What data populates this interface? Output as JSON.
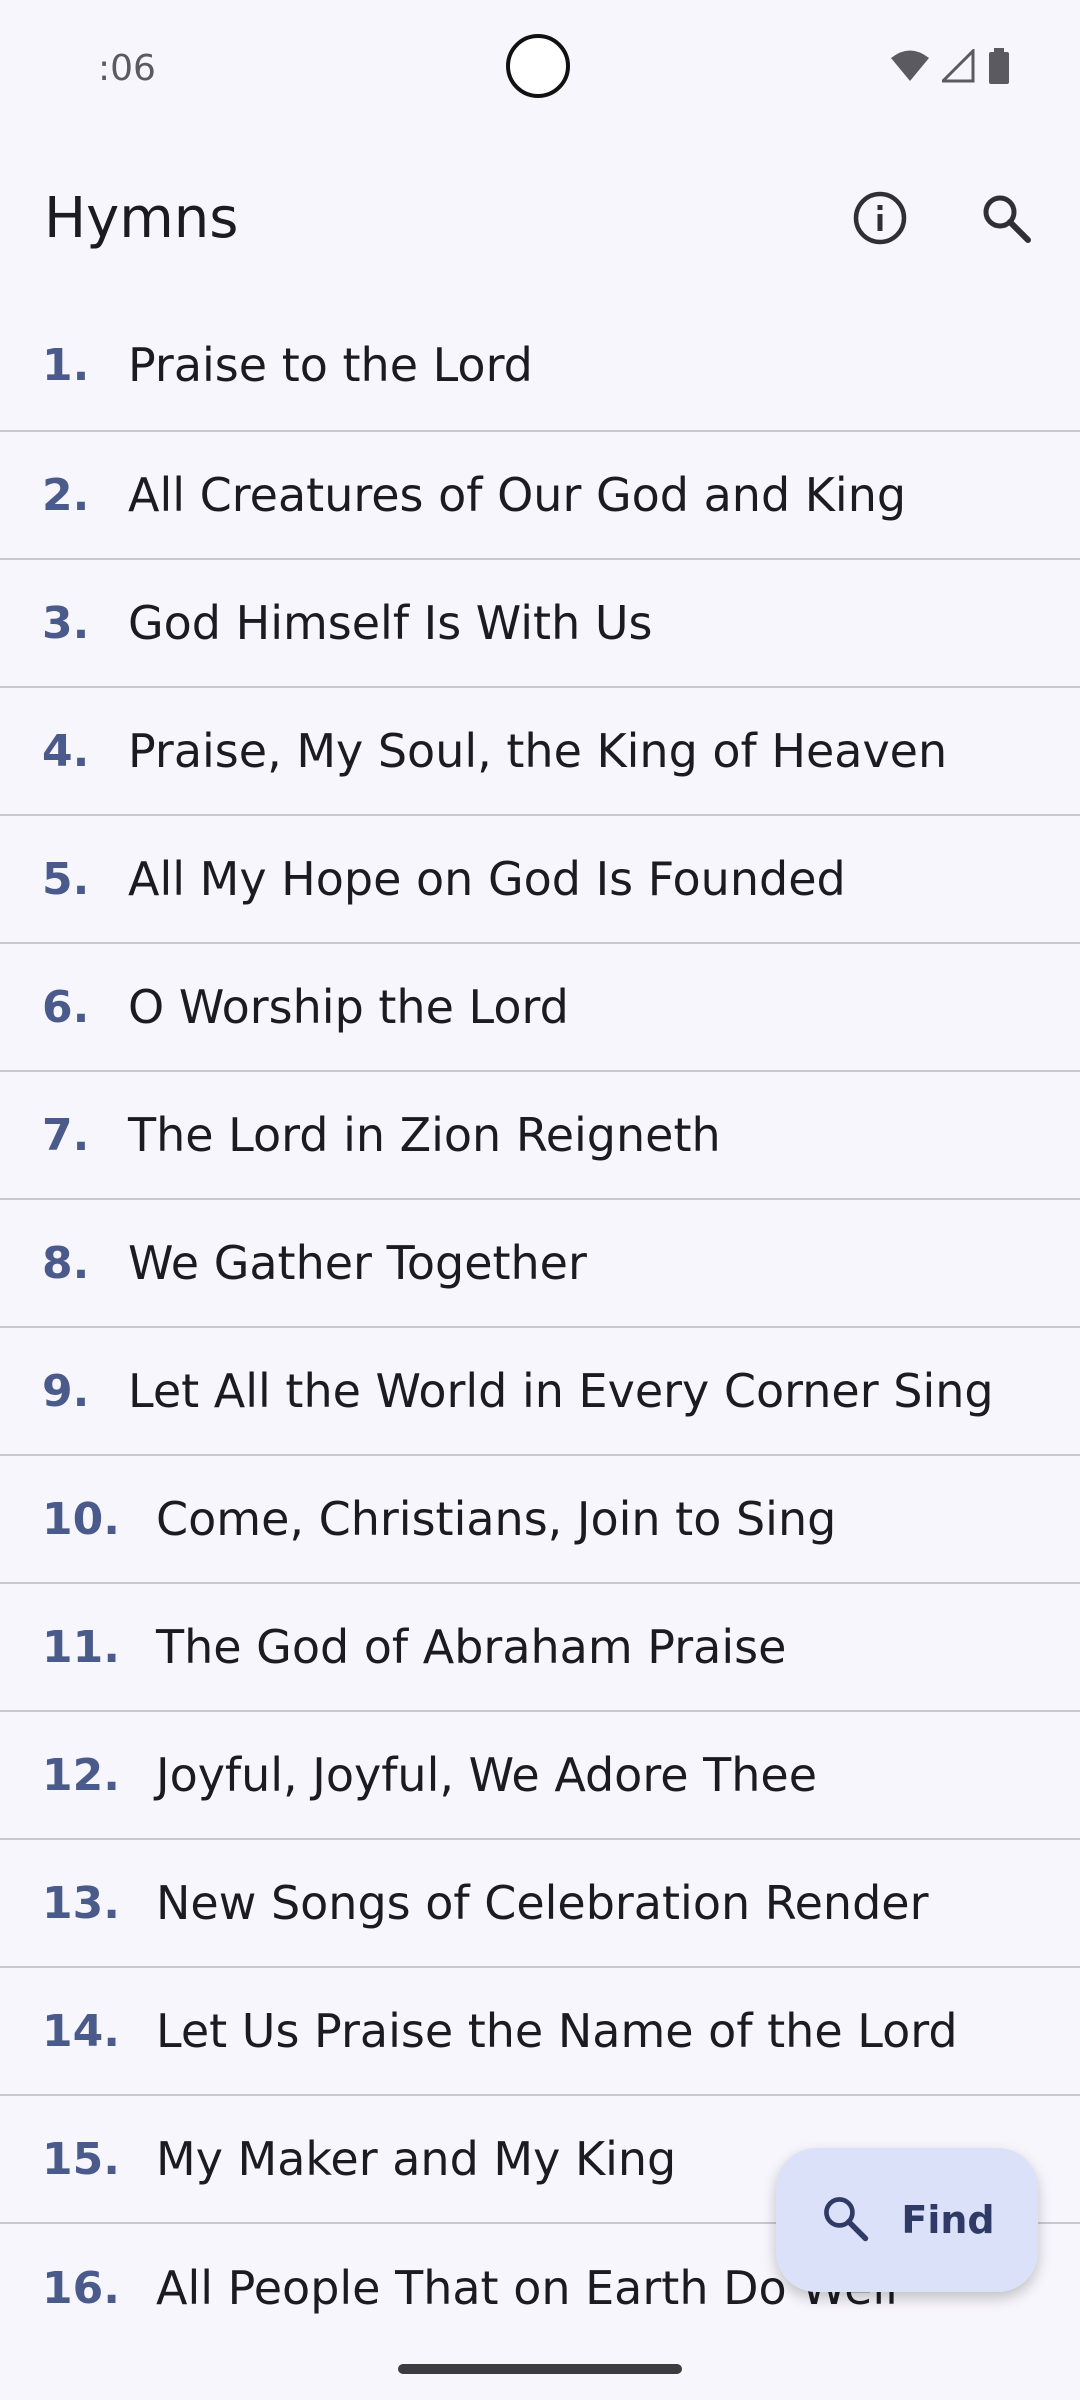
{
  "status_bar": {
    "time": ":06",
    "icons": [
      "wifi-icon",
      "cell-signal-icon",
      "battery-icon"
    ]
  },
  "app_bar": {
    "title": "Hymns",
    "actions": [
      "info-icon",
      "search-icon"
    ]
  },
  "hymns": [
    {
      "num": "1.",
      "title": "Praise to the Lord"
    },
    {
      "num": "2.",
      "title": "All Creatures of Our God and King"
    },
    {
      "num": "3.",
      "title": "God Himself Is With Us"
    },
    {
      "num": "4.",
      "title": "Praise, My Soul, the King of Heaven"
    },
    {
      "num": "5.",
      "title": "All My Hope on God Is Founded"
    },
    {
      "num": "6.",
      "title": "O Worship the Lord"
    },
    {
      "num": "7.",
      "title": "The Lord in Zion Reigneth"
    },
    {
      "num": "8.",
      "title": "We Gather Together"
    },
    {
      "num": "9.",
      "title": "Let All the World in Every Corner Sing"
    },
    {
      "num": "10.",
      "title": "Come, Christians, Join to Sing"
    },
    {
      "num": "11.",
      "title": "The God of Abraham Praise"
    },
    {
      "num": "12.",
      "title": "Joyful, Joyful, We Adore Thee"
    },
    {
      "num": "13.",
      "title": "New Songs of Celebration Render"
    },
    {
      "num": "14.",
      "title": "Let Us Praise the Name of the Lord"
    },
    {
      "num": "15.",
      "title": "My Maker and My King"
    },
    {
      "num": "16.",
      "title": "All People That on Earth Do Well"
    }
  ],
  "fab": {
    "label": "Find",
    "icon": "search-icon"
  },
  "colors": {
    "background": "#f7f6fc",
    "number": "#4a5a8a",
    "divider": "#c8c7cf",
    "fab_bg": "#dce1fa",
    "fab_text": "#2f3b66"
  }
}
